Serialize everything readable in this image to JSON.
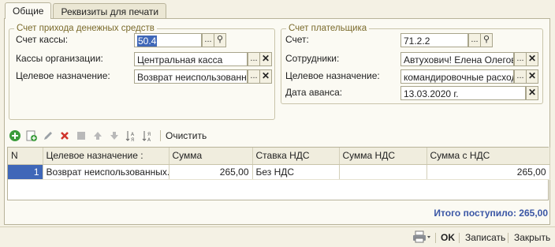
{
  "tabs": [
    {
      "label": "Общие"
    },
    {
      "label": "Реквизиты для печати"
    }
  ],
  "income_account_group": {
    "legend": "Счет прихода денежных средств",
    "fields": [
      {
        "label": "Счет кассы:",
        "value": "50.4",
        "icon": "search-icon"
      },
      {
        "label": "Кассы организации:",
        "value": "Центральная касса",
        "icon": "clear-icon"
      },
      {
        "label": "Целевое назначение:",
        "value": "Возврат неиспользованны",
        "icon": "clear-icon"
      }
    ]
  },
  "payer_account_group": {
    "legend": "Счет плательщика",
    "fields": [
      {
        "label": "Счет:",
        "value": "71.2.2",
        "icon": "search-icon"
      },
      {
        "label": "Сотрудники:",
        "value": "Автухович! Елена Олеговна",
        "icon": "clear-icon"
      },
      {
        "label": "Целевое назначение:",
        "value": "командировочные расход",
        "icon": "clear-icon"
      },
      {
        "label": "Дата аванса:",
        "value": "13.03.2020 г.",
        "icon": "clear-icon"
      }
    ]
  },
  "toolbar": {
    "clear_label": "Очистить"
  },
  "grid": {
    "columns": [
      "N",
      "Целевое назначение",
      "Сумма",
      "Ставка НДС",
      "Сумма НДС",
      "Сумма с НДС"
    ],
    "rows": [
      {
        "n": "1",
        "purpose": "Возврат неиспользованных...",
        "amount": "265,00",
        "vat_rate": "Без НДС",
        "vat_amount": "",
        "amount_with_vat": "265,00"
      }
    ]
  },
  "total": "Итого поступило: 265,00",
  "footer": {
    "ok_label": "OK",
    "save_label": "Записать",
    "close_label": "Закрыть"
  },
  "colors": {
    "accent": "#3f67b8",
    "total_text": "#3a56a5",
    "legend_text": "#7a6a2b"
  }
}
